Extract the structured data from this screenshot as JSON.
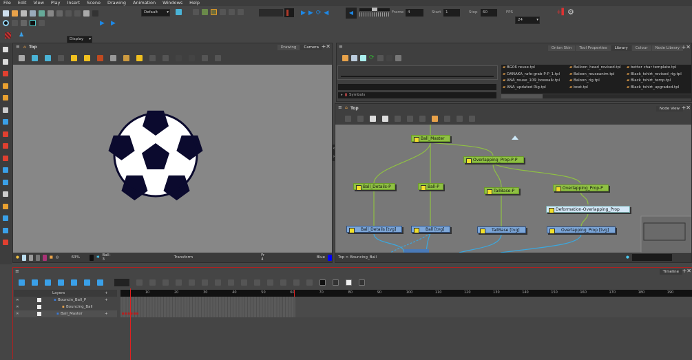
{
  "menu": [
    "File",
    "Edit",
    "View",
    "Play",
    "Insert",
    "Scene",
    "Drawing",
    "Animation",
    "Windows",
    "Help"
  ],
  "toolbar": {
    "row1_icons": [
      {
        "name": "new-scene-icon",
        "c": "#cfe0ee"
      },
      {
        "name": "open-folder-icon",
        "c": "#e8a24a"
      },
      {
        "name": "save-icon",
        "c": "#bbbbbb"
      },
      {
        "name": "save-as-icon",
        "c": "#9ab"
      },
      {
        "name": "import-icon",
        "c": "#6a9"
      },
      {
        "name": "undo-icon",
        "c": "#888"
      },
      {
        "name": "redo-icon",
        "c": "#666"
      },
      {
        "name": "cut-icon",
        "c": "#555"
      },
      {
        "name": "copy-icon",
        "c": "#555"
      },
      {
        "name": "paste-icon",
        "c": "#aaa"
      },
      {
        "name": "delete-icon",
        "c": "#333"
      }
    ],
    "workspace_select": "Default",
    "display_select": "Display",
    "frame_label": "Frame",
    "frame_value": "4",
    "start_label": "Start",
    "start_value": "1",
    "stop_label": "Stop",
    "stop_value": "60",
    "fps_label": "FPS",
    "fps_value": "24",
    "accent": "#1e88e5"
  },
  "camera_view": {
    "title": "Top",
    "tabs": [
      "Drawing",
      "Camera"
    ],
    "active_tab": "Camera",
    "tool_icons": [
      "grid-icon",
      "light-table-icon",
      "onion-skin-icon",
      "shift-trace-icon",
      "lock-icon",
      "lock-add-icon",
      "line-red-icon",
      "line-icon",
      "lamp-icon",
      "mirror-icon",
      "stack-icon",
      "stack2-icon",
      "stack3-icon",
      "stack4-icon",
      "balance-icon",
      "share-icon"
    ],
    "status": {
      "zoom": "63%",
      "drawing": "Ball-3",
      "tool": "Transform",
      "frame": "Fr 4",
      "colour_name": "Blue",
      "colour": "#0000ff"
    },
    "ball_colors": {
      "dark": "#0b0a2e",
      "light": "#ffffff"
    }
  },
  "library": {
    "tabs": [
      "Onion Skin",
      "Tool Properties",
      "Library",
      "Colour",
      "Node Library"
    ],
    "active_tab": "Library",
    "folders": [
      {
        "label": "Symbols"
      }
    ],
    "templates": [
      "BG06 reuse.tpl",
      "DANAKA_rafe-grab-P-P_1.tpl",
      "ANA_reuse_109_boxwalk.tpl",
      "ANA_updated Rig.tpl",
      "Balloon_head_revised.tpl",
      "Baloon_reuseanim.tpl",
      "Baloon_rig.tpl",
      "bcat.tpl",
      "better char template.tpl",
      "Black_tshirt_revised_rig.tpl",
      "Black_tshirt_temp.tpl",
      "Black_tshirt_upgraded.tpl"
    ]
  },
  "node_view": {
    "title": "Top",
    "tab": "Node View",
    "breadcrumb": [
      "Top",
      ">",
      "Bouncing_Ball"
    ],
    "nodes": {
      "ball_master": "Ball_Master",
      "overlap_pp": "Overlapping_Prop-P-P",
      "ball_details_p": "Ball_Details-P",
      "ball_p": "Ball-P",
      "tailbase_p": "TailBase-P",
      "overlap_p": "Overlapping_Prop-P",
      "deformation": "Deformation-Overlapping_Prop",
      "ball_details_tvg": "Ball_Details  [tvg]",
      "ball_tvg": "Ball  [tvg]",
      "tailbase_tvg": "TailBase  [tvg]",
      "overlap_tvg": "Overlapping_Prop  [tvg]"
    }
  },
  "timeline": {
    "tab": "Timeline",
    "layers_label": "Layers",
    "layers": [
      {
        "name": "Bouncin_Ball_P"
      },
      {
        "name": "Bouncing_Ball"
      },
      {
        "name": "Ball_Master"
      }
    ],
    "ruler": [
      "10",
      "20",
      "30",
      "40",
      "50",
      "60",
      "70",
      "80",
      "90",
      "100",
      "110",
      "120",
      "130",
      "140",
      "150",
      "160",
      "170",
      "180",
      "190"
    ],
    "current_frame": 4,
    "scene_end": 60
  }
}
